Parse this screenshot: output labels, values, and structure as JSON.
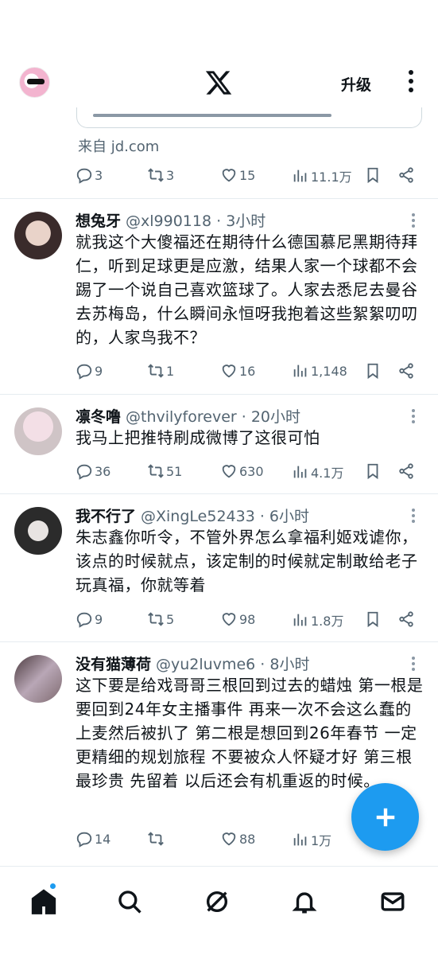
{
  "header": {
    "upgrade_label": "升级"
  },
  "prev_tweet": {
    "source": "来自 jd.com",
    "replies": "3",
    "retweets": "3",
    "likes": "15",
    "views": "11.1万"
  },
  "tweets": [
    {
      "name": "想兔牙",
      "handle": "@xl990118",
      "time": "· 3小时",
      "text": "就我这个大傻福还在期待什么德国慕尼黑期待拜仁，听到足球更是应激，结果人家一个球都不会踢了一个说自己喜欢篮球了。人家去悉尼去曼谷去苏梅岛，什么瞬间永恒呀我抱着这些絮絮叨叨的，人家鸟我不？",
      "replies": "9",
      "retweets": "1",
      "likes": "16",
      "views": "1,148"
    },
    {
      "name": "凛冬噜",
      "handle": "@thvilyforever",
      "time": "· 20小时",
      "text": "我马上把推特刷成微博了这很可怕",
      "replies": "36",
      "retweets": "51",
      "likes": "630",
      "views": "4.1万"
    },
    {
      "name": "我不行了",
      "handle": "@XingLe52433",
      "time": "· 6小时",
      "text": "朱志鑫你听令，不管外界怎么拿福利姬戏谑你，该点的时候就点，该定制的时候就定制敢给老子玩真福，你就等着",
      "replies": "9",
      "retweets": "5",
      "likes": "98",
      "views": "1.8万"
    },
    {
      "name": "没有猫薄荷",
      "handle": "@yu2luvme6",
      "time": "· 8小时",
      "text": "这下要是给戏哥哥三根回到过去的蜡烛 第一根是要回到24年女主播事件 再来一次不会这么蠢的上麦然后被扒了 第二根是想回到26年春节 一定更精细的规划旅程 不要被众人怀疑才好 第三根最珍贵 先留着 以后还会有机重返的时候。",
      "replies": "14",
      "retweets": "",
      "likes": "88",
      "views": "1万"
    }
  ],
  "colors": {
    "accent": "#1d9bf0",
    "text": "#0f1419",
    "muted": "#536471"
  }
}
